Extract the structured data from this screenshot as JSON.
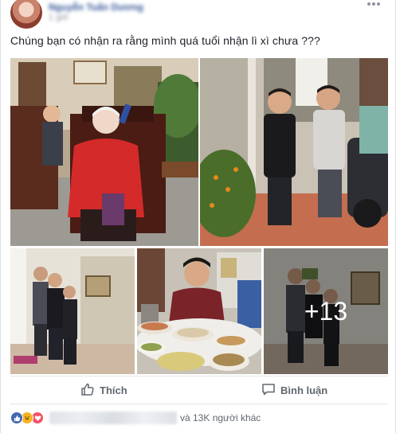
{
  "post": {
    "author": "Nguyễn Tuấn Dương",
    "timestamp": "1 giờ",
    "status_text": "Chúng bạn có nhận ra rằng mình quá tuổi nhận lì xì chưa ???",
    "photos": [
      {
        "id": "photo-grandma"
      },
      {
        "id": "photo-two-boys"
      },
      {
        "id": "photo-boys-hallway"
      },
      {
        "id": "photo-man-eating"
      },
      {
        "id": "photo-more",
        "overlay": "+13"
      }
    ],
    "actions": {
      "like_label": "Thích",
      "comment_label": "Bình luận"
    },
    "reactions": {
      "icons": [
        "like-icon",
        "haha-icon",
        "love-icon"
      ],
      "others_text": "và 13K người khác"
    },
    "colors": {
      "link": "#365899",
      "like_blue": "#4267b2",
      "haha_yellow": "#f7b125",
      "love_red": "#f25268",
      "action_gray": "#606770"
    }
  }
}
